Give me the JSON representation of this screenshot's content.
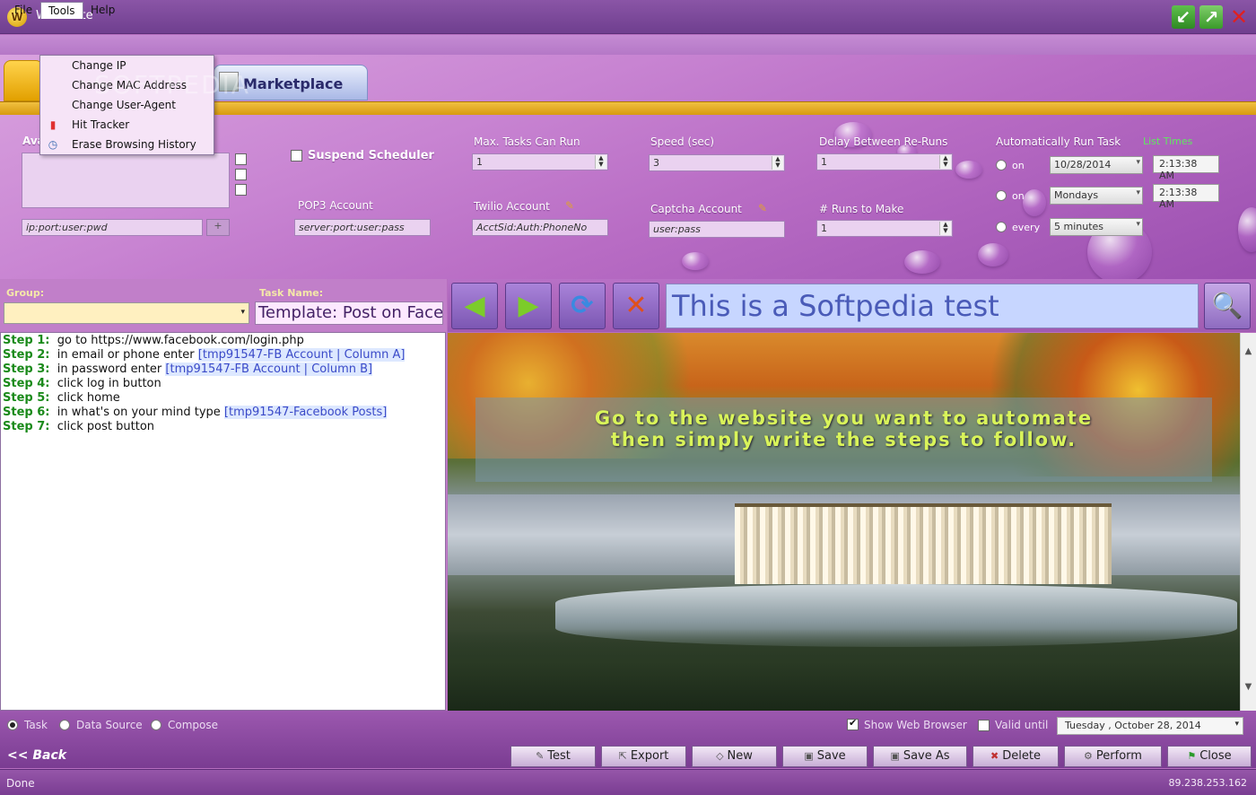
{
  "window": {
    "title": "Webii Lite",
    "logo_letter": "W"
  },
  "menu": {
    "file": "File",
    "tools": "Tools",
    "help": "Help"
  },
  "tools_menu": {
    "items": [
      {
        "label": "Change IP",
        "icon": "none"
      },
      {
        "label": "Change MAC Address",
        "icon": "none"
      },
      {
        "label": "Change User-Agent",
        "icon": "none"
      },
      {
        "label": "Hit Tracker",
        "icon": "bar-chart-icon"
      },
      {
        "label": "Erase Browsing History",
        "icon": "clock-icon"
      }
    ]
  },
  "watermark": "SOFTPEDIA",
  "tabs": {
    "marketplace": "Marketplace"
  },
  "settings": {
    "proxy_label": "Ava",
    "proxy_placeholder": "ip:port:user:pwd",
    "proxy_add": "+",
    "suspend_scheduler": "Suspend Scheduler",
    "pop3_label": "POP3 Account",
    "pop3_placeholder": "server:port:user:pass",
    "max_tasks_label": "Max. Tasks Can Run",
    "max_tasks_value": "1",
    "twilio_label": "Twilio Account",
    "twilio_placeholder": "AcctSid:Auth:PhoneNo",
    "speed_label": "Speed (sec)",
    "speed_value": "3",
    "captcha_label": "Captcha Account",
    "captcha_placeholder": "user:pass",
    "delay_label": "Delay Between Re-Runs",
    "delay_value": "1",
    "runs_label": "# Runs to Make",
    "runs_value": "1",
    "auto_run_label": "Automatically Run Task",
    "list_times": "List Times",
    "on_1": "on",
    "on_2": "on",
    "every": "every",
    "date_value": "10/28/2014",
    "day_value": "Mondays",
    "interval_value": "5 minutes",
    "time_1": "2:13:38 AM",
    "time_2": "2:13:38 AM"
  },
  "task": {
    "group_label": "Group:",
    "task_name_label": "Task Name:",
    "task_name_value": "Template: Post on Facebook"
  },
  "steps": [
    {
      "num": "Step 1:",
      "text": "go to https://www.facebook.com/login.php",
      "token": ""
    },
    {
      "num": "Step 2:",
      "text": "in email or phone enter ",
      "token": "[tmp91547-FB Account | Column A]"
    },
    {
      "num": "Step 3:",
      "text": "in password enter ",
      "token": "[tmp91547-FB Account | Column B]"
    },
    {
      "num": "Step 4:",
      "text": "click log in button",
      "token": ""
    },
    {
      "num": "Step 5:",
      "text": "click home",
      "token": ""
    },
    {
      "num": "Step 6:",
      "text": "in what's on your mind type ",
      "token": "[tmp91547-Facebook Posts]"
    },
    {
      "num": "Step 7:",
      "text": "click post button",
      "token": ""
    }
  ],
  "browser": {
    "url_value": "This is a Softpedia test",
    "overlay_line1": "Go to the website you want to automate",
    "overlay_line2": "then simply write the steps to follow."
  },
  "bottom": {
    "mode_task": "Task",
    "mode_datasource": "Data Source",
    "mode_compose": "Compose",
    "show_browser": "Show Web Browser",
    "valid_until": "Valid until",
    "valid_date": "Tuesday  ,  October  28, 2014",
    "back": "<< Back"
  },
  "actions": {
    "test": "Test",
    "export": "Export",
    "new": "New",
    "save": "Save",
    "save_as": "Save As",
    "delete": "Delete",
    "perform": "Perform",
    "close": "Close"
  },
  "status": {
    "text": "Done",
    "ip": "89.238.253.162"
  },
  "colors": {
    "accent": "#b77ac6",
    "step_green": "#1a8a1a",
    "token_blue": "#3a4ac8",
    "overlay_text": "#d9f45a"
  }
}
